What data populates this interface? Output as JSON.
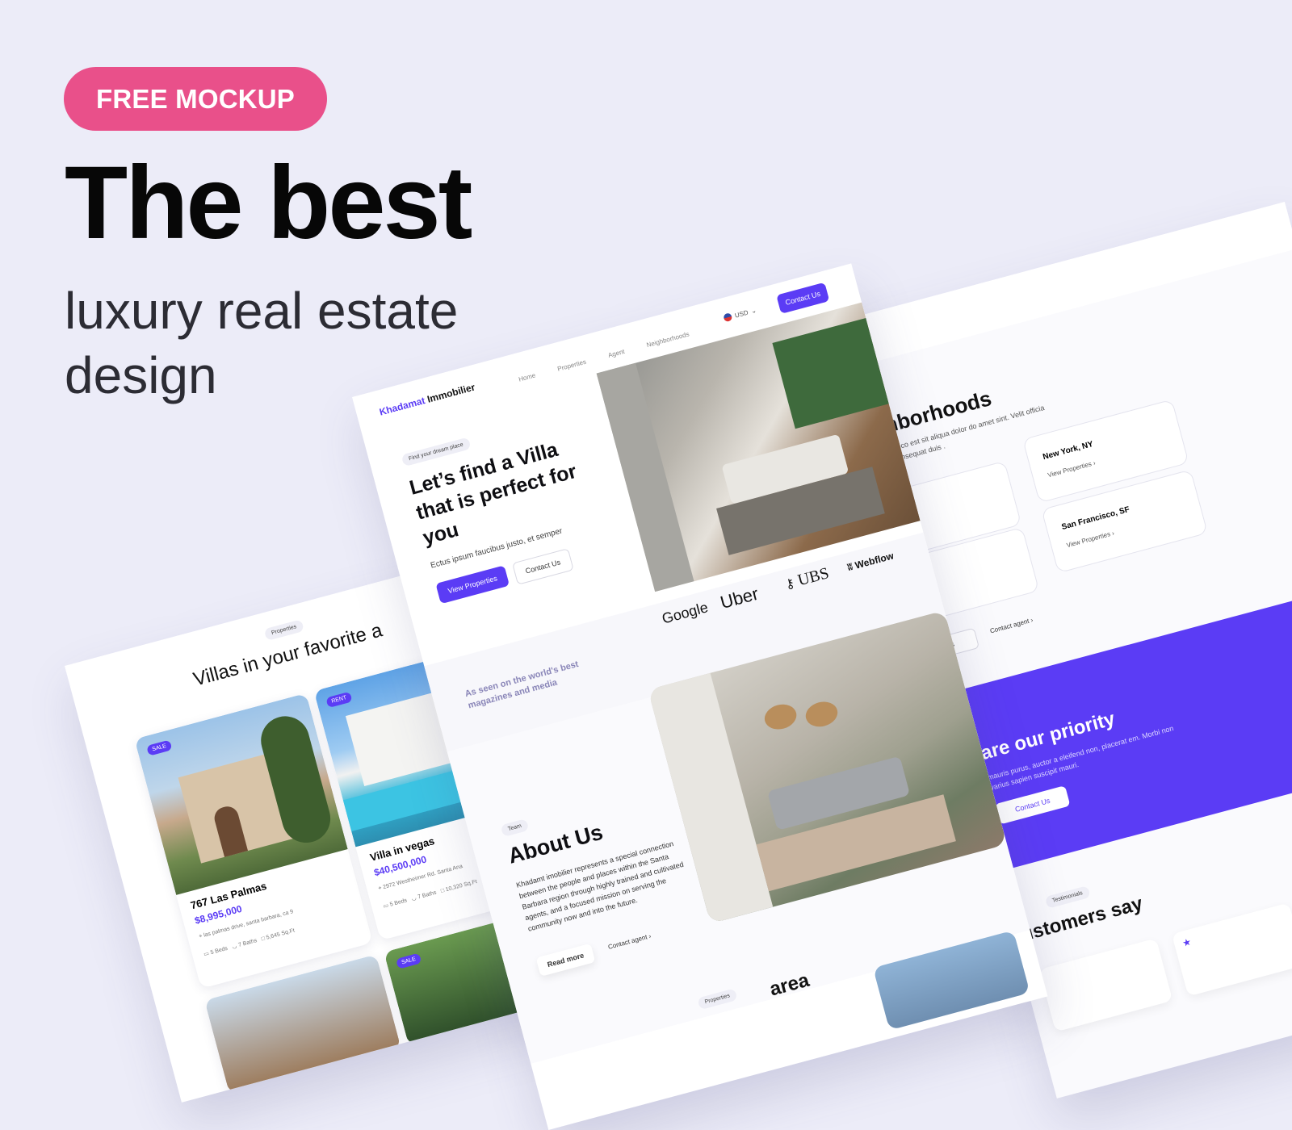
{
  "hero": {
    "badge": "FREE MOCKUP",
    "title": "The best",
    "subtitle": "luxury real estate design"
  },
  "main_page": {
    "brand_first": "Khadamat",
    "brand_second": "Immobilier",
    "nav": [
      "Home",
      "Properties",
      "Agent",
      "Neighborhoods"
    ],
    "currency": "USD",
    "contact_button": "Contact Us",
    "hero_pill": "Find your dream place",
    "hero_title": "Let’s find a Villa that is perfect for you",
    "hero_text": "Ectus ipsum faucibus justo, et semper",
    "view_properties": "View Properties",
    "contact_us": "Contact Us",
    "seen_on": "As seen on the world's best magazines and media",
    "logos": [
      "Google",
      "Uber",
      "UBS",
      "Webflow"
    ],
    "team_pill": "Team",
    "about_title": "About Us",
    "about_text": "Khadamt imobilier represents a special connection between the people and places within the Santa Barbara region through highly trained and cultivated agents, and a focused mission on serving the community now and into the future.",
    "read_more": "Read more",
    "contact_agent": "Contact agent",
    "bottom_pill": "Properties",
    "bottom_title": "area"
  },
  "left_page": {
    "pill": "Properties",
    "title": "Villas in your favorite a",
    "cards": [
      {
        "tag": "SALE",
        "name": "767 Las Palmas",
        "price": "$8,995,000",
        "address": "las palmas drive, santa barbara, ca 9",
        "beds": "5 Beds",
        "baths": "7 Baths",
        "area": "5,645 Sq.Ft"
      },
      {
        "tag": "RENT",
        "name": "Villa in vegas",
        "price": "$40,500,000",
        "address": "2972 Westheimer Rd. Santa Ana",
        "beds": "5 Beds",
        "baths": "7 Baths",
        "area": "10,320 Sq.Ft"
      }
    ],
    "third_tag": "SALE"
  },
  "right_page": {
    "title": "hborhoods",
    "text": "amco est sit aliqua dolor do amet sint. Velit officia consequat duis .",
    "cities": [
      {
        "name": "New York, NY",
        "link": "View Properties"
      },
      {
        "name": "San Francisco, SF",
        "link": "View Properties"
      }
    ],
    "partial_sd": "SD",
    "partial_es1": "es",
    "partial_es2": "es",
    "partial_ties": "ties",
    "contact_agent": "Contact agent",
    "priority_title": "are our priority",
    "priority_text": "mauris purus, auctor a eleifend non, placerat em. Morbi non varius sapien suscipit mauri.",
    "priority_button": "Contact Us",
    "testimonials_pill": "Testimonials",
    "customers_title": "ustomers say"
  }
}
